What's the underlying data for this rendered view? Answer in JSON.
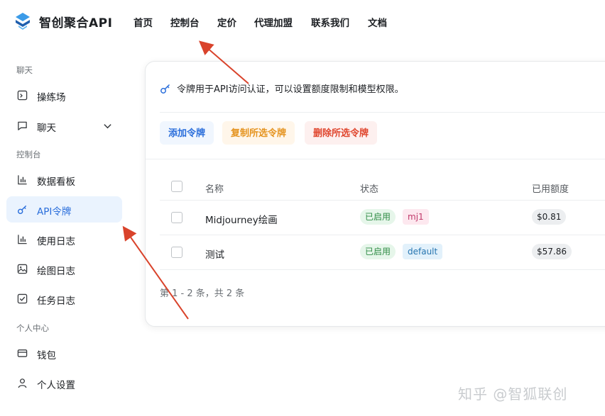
{
  "header": {
    "brand": "智创聚合API",
    "nav": [
      "首页",
      "控制台",
      "定价",
      "代理加盟",
      "联系我们",
      "文档"
    ]
  },
  "sidebar": {
    "groups": {
      "chat": "聊天",
      "console": "控制台",
      "personal": "个人中心"
    },
    "items": [
      {
        "label": "操练场",
        "icon": "terminal-icon"
      },
      {
        "label": "聊天",
        "icon": "chat-icon"
      },
      {
        "label": "数据看板",
        "icon": "bar-chart-icon"
      },
      {
        "label": "API令牌",
        "icon": "key-icon",
        "active": true
      },
      {
        "label": "使用日志",
        "icon": "bar-chart-icon"
      },
      {
        "label": "绘图日志",
        "icon": "image-icon"
      },
      {
        "label": "任务日志",
        "icon": "checkbox-icon"
      },
      {
        "label": "钱包",
        "icon": "wallet-icon"
      },
      {
        "label": "个人设置",
        "icon": "user-icon"
      }
    ]
  },
  "card": {
    "info": "令牌用于API访问认证，可以设置额度限制和模型权限。",
    "buttons": {
      "add": "添加令牌",
      "copy": "复制所选令牌",
      "delete": "删除所选令牌"
    },
    "table": {
      "headers": [
        "名称",
        "状态",
        "已用额度"
      ],
      "rows": [
        {
          "name": "Midjourney绘画",
          "status": "已启用",
          "group": "mj1",
          "used": "$0.81"
        },
        {
          "name": "测试",
          "status": "已启用",
          "group": "default",
          "used": "$57.86"
        }
      ]
    },
    "pagination": "第 1 - 2 条，共 2 条"
  },
  "watermark": "知乎 @智狐联创",
  "colors": {
    "accent": "#2a6edb",
    "active_bg": "#eaf3fe",
    "arrow": "#d9432b"
  }
}
